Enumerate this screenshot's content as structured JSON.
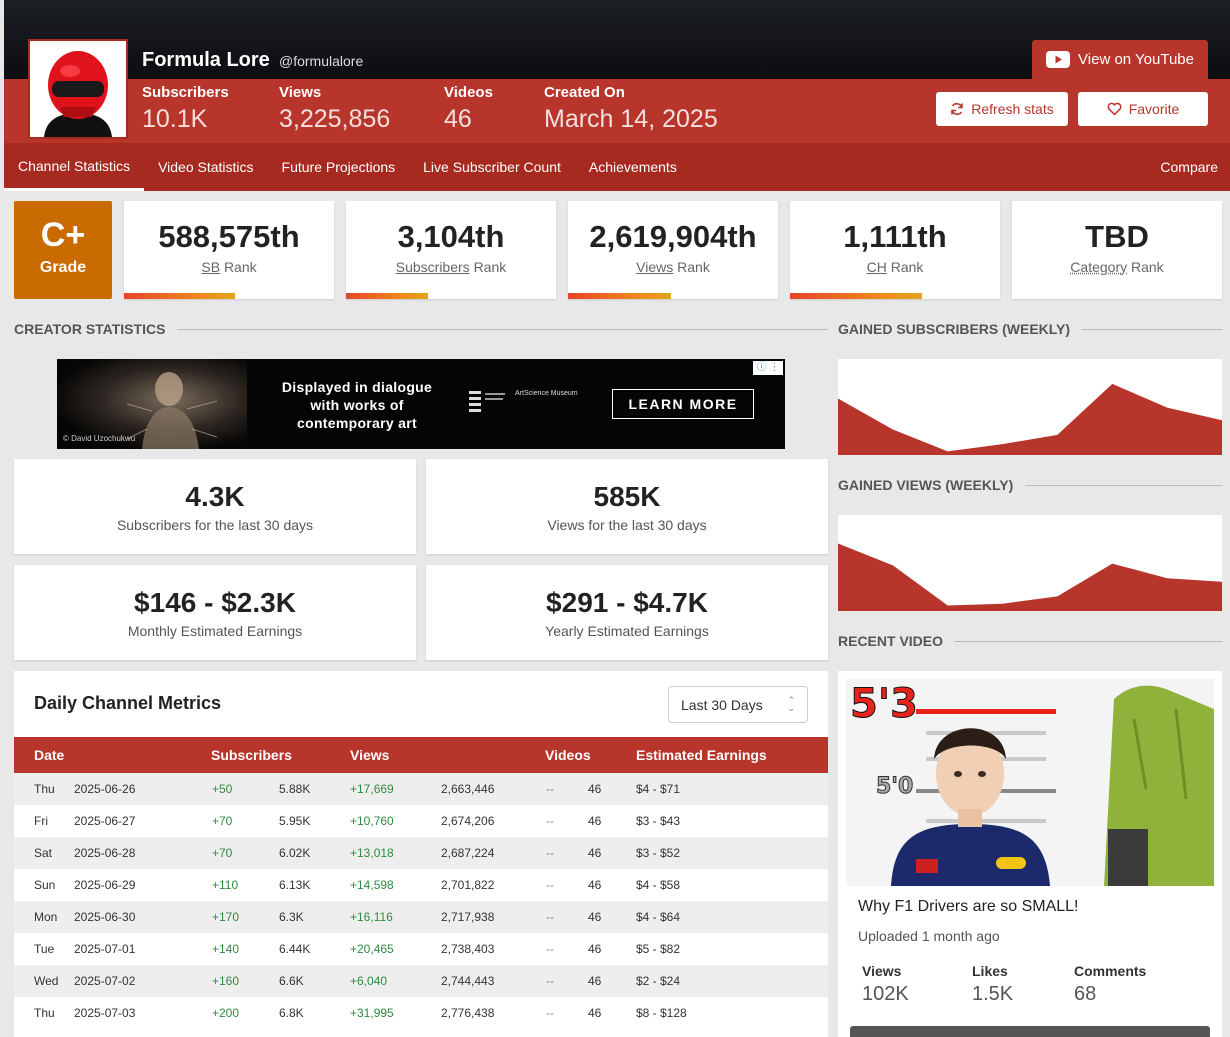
{
  "channel": {
    "name": "Formula Lore",
    "handle": "@formulalore",
    "stats": [
      {
        "label": "Subscribers",
        "value": "10.1K"
      },
      {
        "label": "Views",
        "value": "3,225,856"
      },
      {
        "label": "Videos",
        "value": "46"
      },
      {
        "label": "Created On",
        "value": "March 14, 2025"
      }
    ]
  },
  "actions": {
    "youtube": "View on YouTube",
    "refresh": "Refresh stats",
    "favorite": "Favorite"
  },
  "nav": {
    "tabs": [
      "Channel Statistics",
      "Video Statistics",
      "Future Projections",
      "Live Subscriber Count",
      "Achievements"
    ],
    "active": 0,
    "compare": "Compare"
  },
  "grade": {
    "value": "C+",
    "label": "Grade"
  },
  "ranks": [
    {
      "value": "588,575th",
      "link": "SB",
      "suffix": "Rank",
      "bar_fraction": 0.53
    },
    {
      "value": "3,104th",
      "link": "Subscribers",
      "suffix": "Rank",
      "bar_fraction": 0.39
    },
    {
      "value": "2,619,904th",
      "link": "Views",
      "suffix": "Rank",
      "bar_fraction": 0.49
    },
    {
      "value": "1,111th",
      "link": "CH",
      "suffix": "Rank",
      "bar_fraction": 0.63
    },
    {
      "value": "TBD",
      "link": "Category",
      "suffix": "Rank",
      "bar_fraction": 0
    }
  ],
  "sections": {
    "creator": "CREATOR STATISTICS",
    "gained_subs": "GAINED SUBSCRIBERS (WEEKLY)",
    "gained_views": "GAINED VIEWS (WEEKLY)",
    "recent_video": "RECENT VIDEO"
  },
  "ad": {
    "credit": "© David Uzochukwu",
    "text": "Displayed in dialogue with works of contemporary art",
    "logo_text": "ArtScience Museum",
    "button": "LEARN MORE"
  },
  "summary": [
    {
      "value": "4.3K",
      "label": "Subscribers for the last 30 days"
    },
    {
      "value": "585K",
      "label": "Views for the last 30 days"
    },
    {
      "value": "$146 - $2.3K",
      "label": "Monthly Estimated Earnings"
    },
    {
      "value": "$291 - $4.7K",
      "label": "Yearly Estimated Earnings"
    }
  ],
  "metrics": {
    "title": "Daily Channel Metrics",
    "range": "Last 30 Days",
    "columns": [
      "Date",
      "Subscribers",
      "Views",
      "Videos",
      "Estimated Earnings"
    ],
    "rows": [
      {
        "day": "Thu",
        "date": "2025-06-26",
        "sub_delta": "+50",
        "subs": "5.88K",
        "view_delta": "+17,669",
        "views": "2,663,446",
        "vid_delta": "--",
        "videos": "46",
        "earnings": "$4 - $71"
      },
      {
        "day": "Fri",
        "date": "2025-06-27",
        "sub_delta": "+70",
        "subs": "5.95K",
        "view_delta": "+10,760",
        "views": "2,674,206",
        "vid_delta": "--",
        "videos": "46",
        "earnings": "$3 - $43"
      },
      {
        "day": "Sat",
        "date": "2025-06-28",
        "sub_delta": "+70",
        "subs": "6.02K",
        "view_delta": "+13,018",
        "views": "2,687,224",
        "vid_delta": "--",
        "videos": "46",
        "earnings": "$3 - $52"
      },
      {
        "day": "Sun",
        "date": "2025-06-29",
        "sub_delta": "+110",
        "subs": "6.13K",
        "view_delta": "+14,598",
        "views": "2,701,822",
        "vid_delta": "--",
        "videos": "46",
        "earnings": "$4 - $58"
      },
      {
        "day": "Mon",
        "date": "2025-06-30",
        "sub_delta": "+170",
        "subs": "6.3K",
        "view_delta": "+16,116",
        "views": "2,717,938",
        "vid_delta": "--",
        "videos": "46",
        "earnings": "$4 - $64"
      },
      {
        "day": "Tue",
        "date": "2025-07-01",
        "sub_delta": "+140",
        "subs": "6.44K",
        "view_delta": "+20,465",
        "views": "2,738,403",
        "vid_delta": "--",
        "videos": "46",
        "earnings": "$5 - $82"
      },
      {
        "day": "Wed",
        "date": "2025-07-02",
        "sub_delta": "+160",
        "subs": "6.6K",
        "view_delta": "+6,040",
        "views": "2,744,443",
        "vid_delta": "--",
        "videos": "46",
        "earnings": "$2 - $24"
      },
      {
        "day": "Thu",
        "date": "2025-07-03",
        "sub_delta": "+200",
        "subs": "6.8K",
        "view_delta": "+31,995",
        "views": "2,776,438",
        "vid_delta": "--",
        "videos": "46",
        "earnings": "$8 - $128"
      }
    ]
  },
  "weekly_subs": [
    0.62,
    0.28,
    0.04,
    0.12,
    0.22,
    0.78,
    0.52,
    0.38
  ],
  "weekly_views": [
    0.74,
    0.5,
    0.06,
    0.08,
    0.16,
    0.52,
    0.36,
    0.32
  ],
  "video": {
    "thumb_big": "5'3",
    "thumb_small": "5'0",
    "title": "Why F1 Drivers are so SMALL!",
    "uploaded": "Uploaded 1 month ago",
    "stats": [
      {
        "label": "Views",
        "value": "102K"
      },
      {
        "label": "Likes",
        "value": "1.5K"
      },
      {
        "label": "Comments",
        "value": "68"
      }
    ]
  },
  "colors": {
    "accent": "#b8352b",
    "accent_dark": "#a62a20",
    "grade": "#c96b00",
    "positive": "#2e8b3e"
  }
}
